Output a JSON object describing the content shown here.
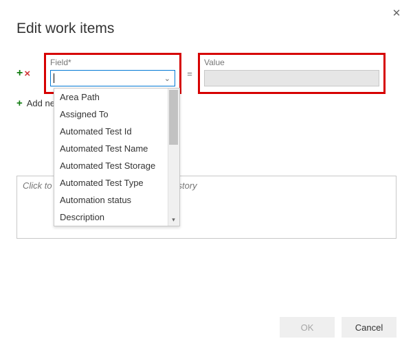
{
  "dialog": {
    "title": "Edit work items",
    "close_icon": "✕"
  },
  "row": {
    "field_label": "Field*",
    "value_label": "Value",
    "equals": "=",
    "add_icon": "+",
    "remove_icon": "×",
    "add_new_label": "Add new field"
  },
  "dropdown": {
    "options": [
      "Area Path",
      "Assigned To",
      "Automated Test Id",
      "Automated Test Name",
      "Automated Test Storage",
      "Automated Test Type",
      "Automation status",
      "Description"
    ]
  },
  "notes": {
    "placeholder": "Click to add notes to be appended to history"
  },
  "footer": {
    "ok": "OK",
    "cancel": "Cancel"
  }
}
